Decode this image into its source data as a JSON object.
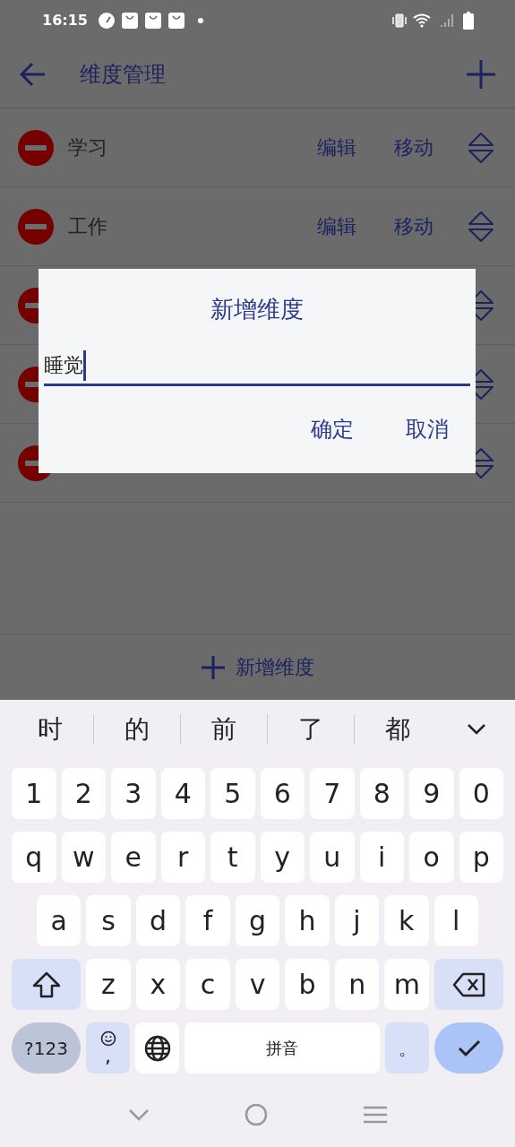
{
  "status_bar": {
    "time": "16:15"
  },
  "app_bar": {
    "title": "维度管理"
  },
  "rows": [
    {
      "label": "学习",
      "edit": "编辑",
      "move": "移动"
    },
    {
      "label": "工作",
      "edit": "编辑",
      "move": "移动"
    },
    {},
    {},
    {}
  ],
  "add_bar": {
    "label": "新增维度"
  },
  "dialog": {
    "title": "新增维度",
    "value": "睡觉",
    "buttons": [
      "确定",
      "取消"
    ]
  },
  "candidates": [
    "时",
    "的",
    "前",
    "了",
    "都"
  ],
  "keyboard": [
    [
      {
        "kind": "char",
        "label": "1"
      },
      {
        "kind": "char",
        "label": "2"
      },
      {
        "kind": "char",
        "label": "3"
      },
      {
        "kind": "char",
        "label": "4"
      },
      {
        "kind": "char",
        "label": "5"
      },
      {
        "kind": "char",
        "label": "6"
      },
      {
        "kind": "char",
        "label": "7"
      },
      {
        "kind": "char",
        "label": "8"
      },
      {
        "kind": "char",
        "label": "9"
      },
      {
        "kind": "char",
        "label": "0"
      }
    ],
    [
      {
        "kind": "char",
        "label": "q"
      },
      {
        "kind": "char",
        "label": "w"
      },
      {
        "kind": "char",
        "label": "e"
      },
      {
        "kind": "char",
        "label": "r"
      },
      {
        "kind": "char",
        "label": "t"
      },
      {
        "kind": "char",
        "label": "y"
      },
      {
        "kind": "char",
        "label": "u"
      },
      {
        "kind": "char",
        "label": "i"
      },
      {
        "kind": "char",
        "label": "o"
      },
      {
        "kind": "char",
        "label": "p"
      }
    ],
    [
      {
        "kind": "char",
        "label": "a"
      },
      {
        "kind": "char",
        "label": "s"
      },
      {
        "kind": "char",
        "label": "d"
      },
      {
        "kind": "char",
        "label": "f"
      },
      {
        "kind": "char",
        "label": "g"
      },
      {
        "kind": "char",
        "label": "h"
      },
      {
        "kind": "char",
        "label": "j"
      },
      {
        "kind": "char",
        "label": "k"
      },
      {
        "kind": "char",
        "label": "l"
      }
    ],
    [
      {
        "kind": "shift"
      },
      {
        "kind": "char",
        "label": "z"
      },
      {
        "kind": "char",
        "label": "x"
      },
      {
        "kind": "char",
        "label": "c"
      },
      {
        "kind": "char",
        "label": "v"
      },
      {
        "kind": "char",
        "label": "b"
      },
      {
        "kind": "char",
        "label": "n"
      },
      {
        "kind": "char",
        "label": "m"
      },
      {
        "kind": "backspace"
      }
    ],
    [
      {
        "kind": "symbols",
        "label": "?123"
      },
      {
        "kind": "emoji",
        "label": ","
      },
      {
        "kind": "globe"
      },
      {
        "kind": "space",
        "label": "拼音"
      },
      {
        "kind": "period",
        "label": "。"
      },
      {
        "kind": "enter"
      }
    ]
  ]
}
